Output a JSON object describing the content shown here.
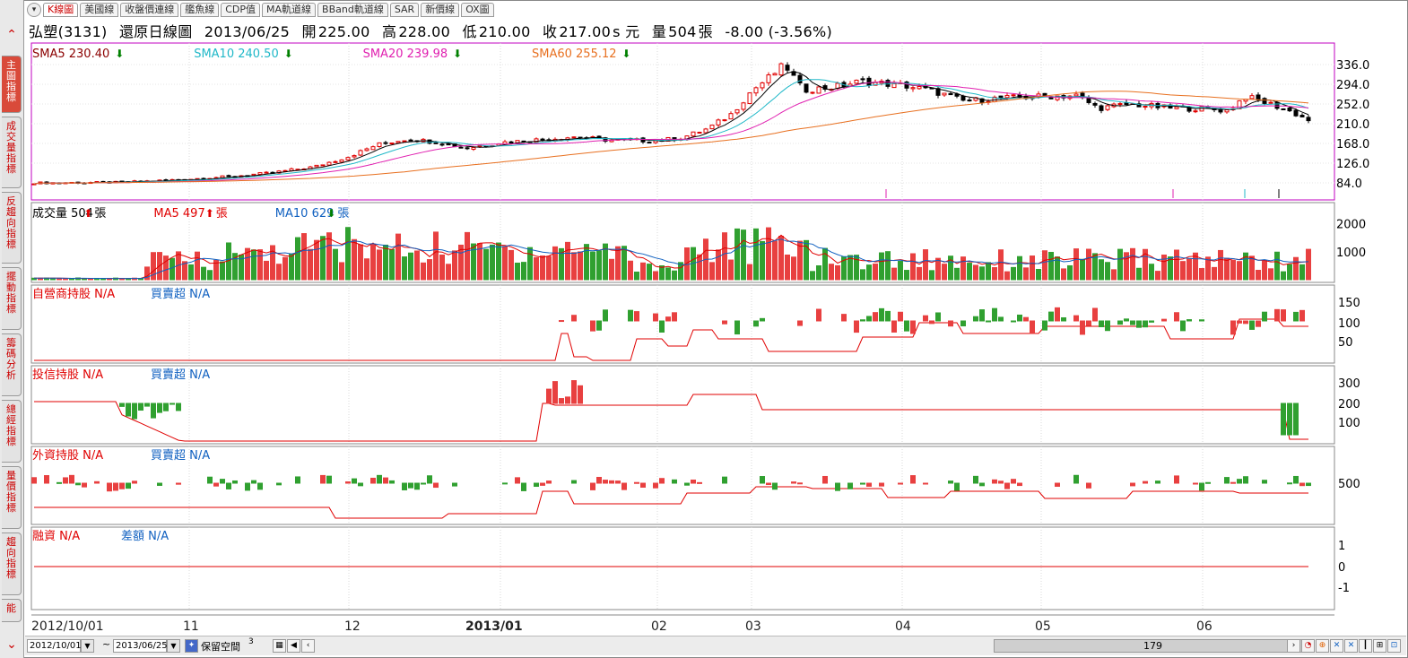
{
  "tabs": [
    "K線圖",
    "美國線",
    "收盤價連線",
    "艦魚線",
    "CDP值",
    "MA軌道線",
    "BBand軌道線",
    "SAR",
    "新價線",
    "OX圖"
  ],
  "sidebar": [
    "主圖指標",
    "成交量指標",
    "反趨向指標",
    "擺動指標",
    "籌碼分析",
    "總經指標",
    "量價指標",
    "趨向指標",
    "能"
  ],
  "header": {
    "stock": "弘塑(3131)",
    "chart_name": "還原日線圖",
    "date": "2013/06/25",
    "open_label": "開",
    "open": "225.00",
    "high_label": "高",
    "high": "228.00",
    "low_label": "低",
    "low": "210.00",
    "close_label": "收",
    "close": "217.00",
    "unit": "s 元",
    "volume_label": "量",
    "volume": "504",
    "volume_unit": "張",
    "change": "-8.00 (-3.56%)"
  },
  "legend_price": [
    {
      "text": "SMA5 230.40",
      "color": "#8b0000"
    },
    {
      "text": "SMA10 240.50",
      "color": "#20b8c8"
    },
    {
      "text": "SMA20 239.98",
      "color": "#e020b0"
    },
    {
      "text": "SMA60 255.12",
      "color": "#e87020"
    }
  ],
  "legend_volume": [
    {
      "text": "成交量 504",
      "arrow": "up",
      "unit": "張",
      "color": "#000"
    },
    {
      "text": "MA5 497",
      "arrow": "up",
      "unit": "張",
      "color": "#e00000"
    },
    {
      "text": "MA10 629",
      "arrow": "down",
      "unit": "張",
      "color": "#1060c0"
    }
  ],
  "panels": {
    "dealer": {
      "label": "自營商持股",
      "value": "N/A",
      "label2": "買賣超",
      "value2": "N/A"
    },
    "trust": {
      "label": "投信持股",
      "value": "N/A",
      "label2": "買賣超",
      "value2": "N/A"
    },
    "foreign": {
      "label": "外資持股",
      "value": "N/A",
      "label2": "買賣超",
      "value2": "N/A"
    },
    "margin": {
      "label": "融資",
      "value": "N/A",
      "label2": "差額",
      "value2": "N/A"
    }
  },
  "axes": {
    "price_ticks": [
      "336.0",
      "294.0",
      "252.0",
      "210.0",
      "168.0",
      "126.0",
      "84.0"
    ],
    "volume_ticks": [
      "2000",
      "1000"
    ],
    "dealer_ticks": [
      "150",
      "100",
      "50"
    ],
    "trust_ticks": [
      "300",
      "200",
      "100"
    ],
    "foreign_ticks": [
      "500"
    ],
    "margin_ticks": [
      "1",
      "0",
      "-1"
    ],
    "x_labels": [
      "2012/10/01",
      "11",
      "12",
      "2013/01",
      "02",
      "03",
      "04",
      "05",
      "06"
    ]
  },
  "bottom": {
    "start_date": "2012/10/01",
    "tilde": "~",
    "end_date": "2013/06/25",
    "reserve_label": "保留空間",
    "reserve_value": "3",
    "scroll_value": "179"
  },
  "chart_data": {
    "type": "candlestick",
    "title": "弘塑(3131) 還原日線圖",
    "x_range": [
      "2012/10/01",
      "2013/06/25"
    ],
    "ylim": [
      84,
      336
    ],
    "monthly_close_approx": [
      {
        "month": "2012/10",
        "close": 84
      },
      {
        "month": "2012/11",
        "close": 100
      },
      {
        "month": "2012/12",
        "close": 170
      },
      {
        "month": "2013/01",
        "close": 175
      },
      {
        "month": "2013/02",
        "close": 170
      },
      {
        "month": "2013/03",
        "close": 300
      },
      {
        "month": "2013/04",
        "close": 275
      },
      {
        "month": "2013/05",
        "close": 245
      },
      {
        "month": "2013/06",
        "close": 217
      }
    ],
    "last_bar": {
      "date": "2013/06/25",
      "open": 225.0,
      "high": 228.0,
      "low": 210.0,
      "close": 217.0,
      "volume": 504
    }
  }
}
